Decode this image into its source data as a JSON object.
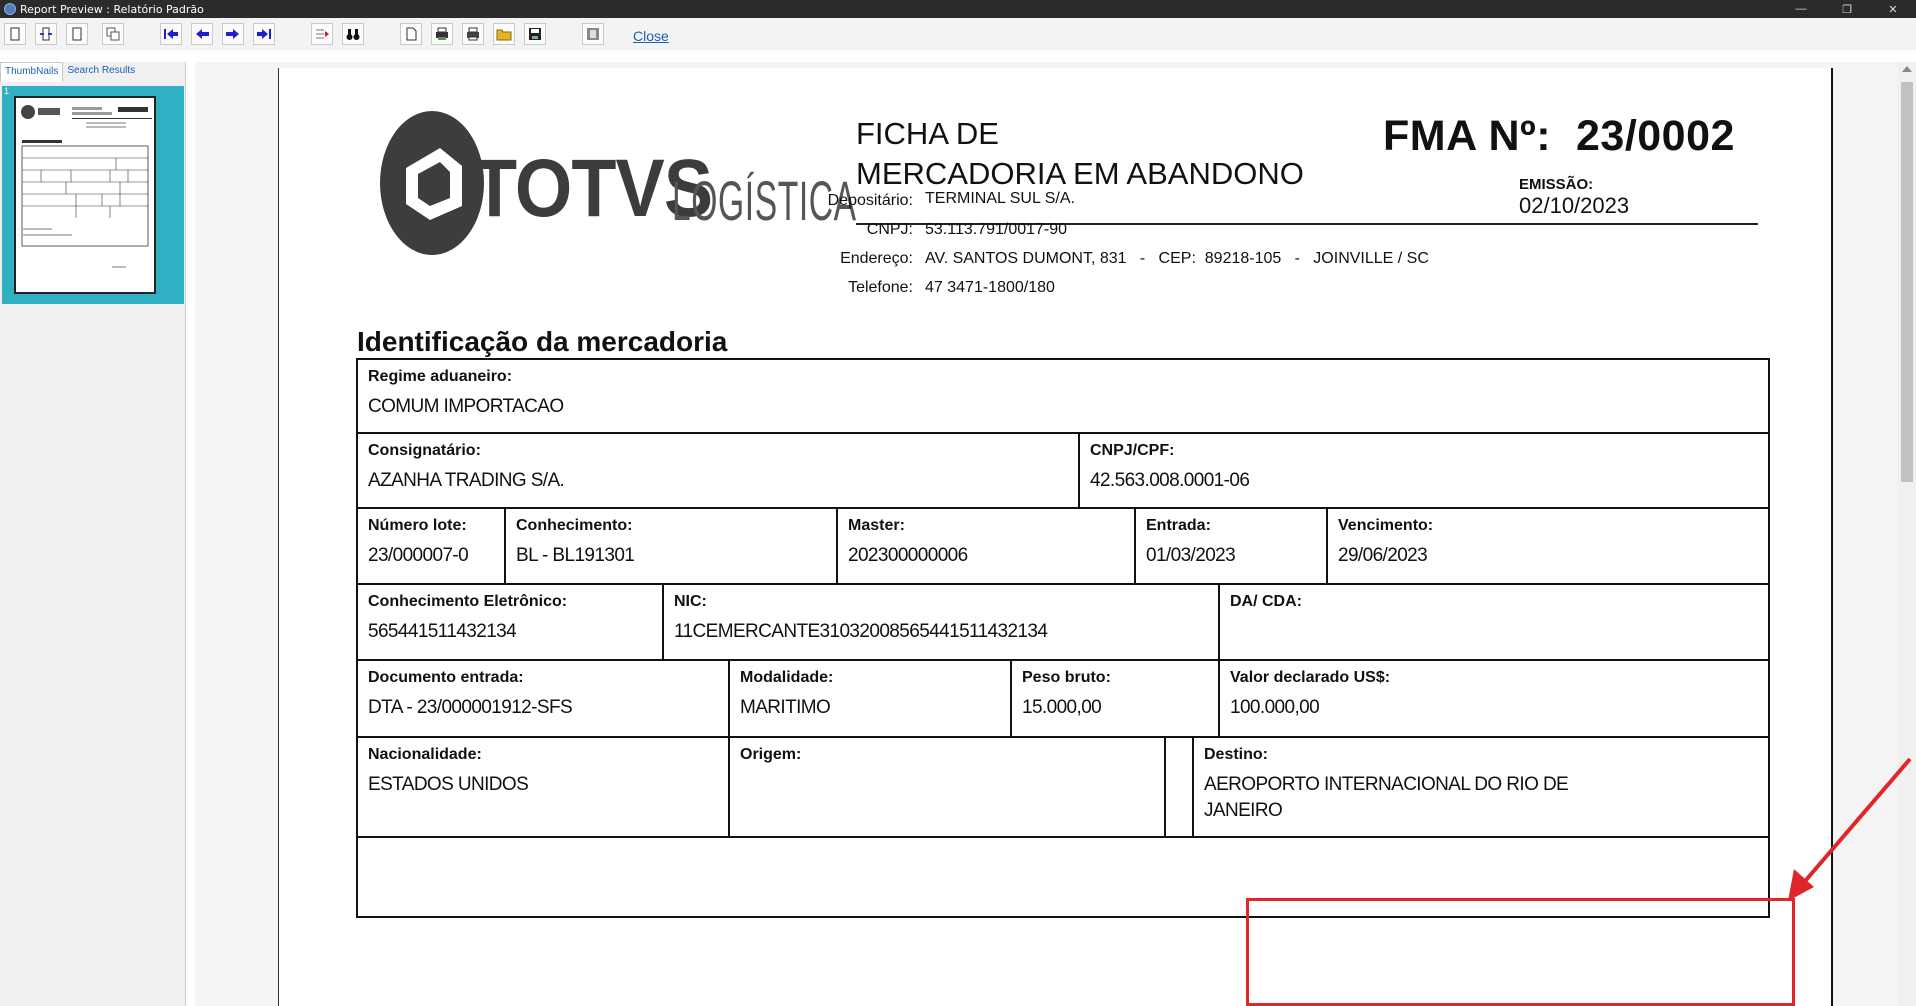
{
  "window": {
    "title": "Report Preview :  Relatório Padrão"
  },
  "toolbar": {
    "close_label": "Close",
    "buttons": [
      "new-page-icon",
      "page-split-icon",
      "blank-page-icon",
      "copy-pages-icon",
      "first-page-icon",
      "previous-page-icon",
      "next-page-icon",
      "last-page-icon",
      "goto-page-icon",
      "binoculars-icon",
      "document-icon",
      "printer-setup-icon",
      "printer-icon",
      "open-folder-icon",
      "save-icon",
      "export-icon"
    ]
  },
  "left_panel": {
    "tabs": [
      "ThumbNails",
      "Search Results"
    ],
    "thumbnail_page_number": "1"
  },
  "report": {
    "logo_text": "TOTVS",
    "logo_sub": "LOGÍSTICA",
    "title_line1": "FICHA DE",
    "title_line2": "MERCADORIA EM ABANDONO",
    "fma_label": "FMA Nº:",
    "fma_number": "23/0002",
    "emissao_label": "EMISSÃO:",
    "emissao_date": "02/10/2023",
    "depositario_label": "Depositário:",
    "depositario": "TERMINAL SUL S/A.",
    "cnpj_label": "CNPJ:",
    "cnpj": "53.113.791/0017-90",
    "endereco_label": "Endereço:",
    "endereco": "AV. SANTOS DUMONT, 831   -   CEP:  89218-105   -   JOINVILLE / SC",
    "telefone_label": "Telefone:",
    "telefone": "47 3471-1800/180",
    "section_title": "Identificação da mercadoria",
    "fields": {
      "regime_label": "Regime aduaneiro:",
      "regime": "COMUM IMPORTACAO",
      "consignatario_label": "Consignatário:",
      "consignatario": "AZANHA TRADING S/A.",
      "cnpjcpf_label": "CNPJ/CPF:",
      "cnpjcpf": "42.563.008.0001-06",
      "numero_lote_label": "Número lote:",
      "numero_lote": "23/000007-0",
      "conhecimento_label": "Conhecimento:",
      "conhecimento": "BL - BL191301",
      "master_label": "Master:",
      "master": "202300000006",
      "entrada_label": "Entrada:",
      "entrada": "01/03/2023",
      "vencimento_label": "Vencimento:",
      "vencimento": "29/06/2023",
      "conh_eletronico_label": "Conhecimento Eletrônico:",
      "conh_eletronico": "565441511432134",
      "nic_label": "NIC:",
      "nic": "11CEMERCANTE3103200856544151143213​4",
      "da_cda_label": "DA/ CDA:",
      "documento_entrada_label": "Documento entrada:",
      "documento_entrada": "DTA - 23/000001912-SFS",
      "modalidade_label": "Modalidade:",
      "modalidade": "MARITIMO",
      "peso_bruto_label": "Peso bruto:",
      "peso_bruto": "15.000,00",
      "valor_declarado_label": "Valor declarado US$:",
      "valor_declarado": "100.000,00",
      "nacionalidade_label": "Nacionalidade:",
      "nacionalidade": "ESTADOS UNIDOS",
      "origem_label": "Origem:",
      "destino_label": "Destino:",
      "destino_line1": "AEROPORTO INTERNACIONAL DO RIO DE",
      "destino_line2": "JANEIRO"
    }
  },
  "annotation": {
    "color": "#e0262a"
  }
}
